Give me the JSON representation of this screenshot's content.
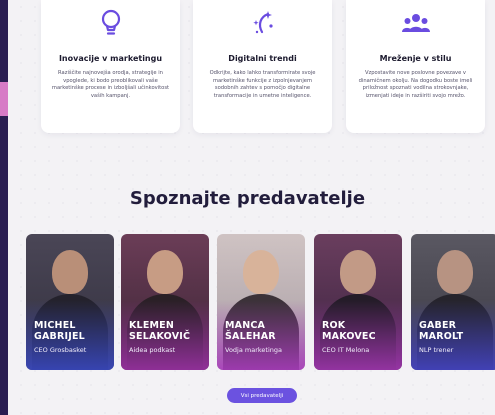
{
  "features": [
    {
      "icon": "lightbulb-icon",
      "title": "Inovacije v marketingu",
      "desc": "Raziščite najnovejša orodja, strategije in vpoglede, ki bodo preoblikovali vaše marketinške procese in izboljšali učinkovitost vaših kampanj."
    },
    {
      "icon": "sparkle-wand-icon",
      "title": "Digitalni trendi",
      "desc": "Odkrijte, kako lahko transformirate svoje marketinške funkcije z izpolnjevanjem sodobnih zahtev s pomočjo digitalne transformacije in umetne inteligence."
    },
    {
      "icon": "people-group-icon",
      "title": "Mreženje v stilu",
      "desc": "Vzpostavite nove poslovne povezave v dinamičnem okolju. Na dogodku boste imeli priložnost spoznati vodilna strokovnjake, izmenjati ideje in razširiti svojo mrežo."
    }
  ],
  "speakers_section": {
    "title": "Spoznajte predavatelje",
    "button_label": "Vsi predavatelji"
  },
  "speakers": [
    {
      "first": "MICHEL",
      "last": "GABRIJEL",
      "role": "CEO Grosbasket"
    },
    {
      "first": "KLEMEN",
      "last": "SELAKOVIČ",
      "role": "Aidea podkast"
    },
    {
      "first": "MANCA",
      "last": "ŠALEHAR",
      "role": "Vodja marketinga"
    },
    {
      "first": "ROK",
      "last": "MAKOVEC",
      "role": "CEO IT Melona"
    },
    {
      "first": "GABER",
      "last": "MAROLT",
      "role": "NLP trener"
    }
  ],
  "colors": {
    "accent": "#6b52e0",
    "icon_purple": "#6a4ce0",
    "dark_strip": "#2a1e52",
    "pink_accent": "#d77bc6"
  }
}
